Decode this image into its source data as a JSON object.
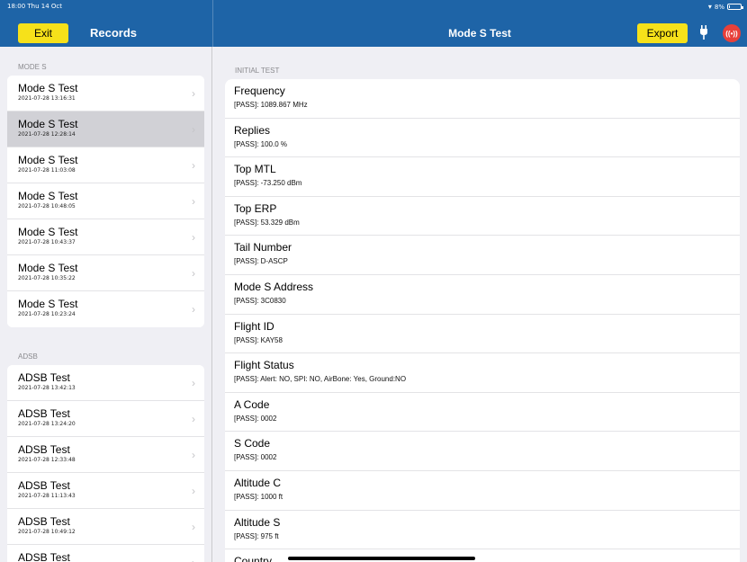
{
  "status": {
    "time": "18:00  Thu 14 Oct",
    "battery": "8%",
    "battery_level": 0.08
  },
  "header": {
    "exit_label": "Exit",
    "records_title": "Records",
    "page_title": "Mode S Test",
    "export_label": "Export",
    "broadcast_glyph": "((•))"
  },
  "sidebar": {
    "mode_s_header": "MODE S",
    "mode_s_items": [
      {
        "title": "Mode S Test",
        "date": "2021-07-28 13:16:31"
      },
      {
        "title": "Mode S Test",
        "date": "2021-07-28 12:28:14",
        "selected": true
      },
      {
        "title": "Mode S Test",
        "date": "2021-07-28 11:03:08"
      },
      {
        "title": "Mode S Test",
        "date": "2021-07-28 10:48:05"
      },
      {
        "title": "Mode S Test",
        "date": "2021-07-28 10:43:37"
      },
      {
        "title": "Mode S Test",
        "date": "2021-07-28 10:35:22"
      },
      {
        "title": "Mode S Test",
        "date": "2021-07-28 10:23:24"
      }
    ],
    "adsb_header": "ADSB",
    "adsb_items": [
      {
        "title": "ADSB Test",
        "date": "2021-07-28 13:42:13"
      },
      {
        "title": "ADSB Test",
        "date": "2021-07-28 13:24:20"
      },
      {
        "title": "ADSB Test",
        "date": "2021-07-28 12:33:48"
      },
      {
        "title": "ADSB Test",
        "date": "2021-07-28 11:13:43"
      },
      {
        "title": "ADSB Test",
        "date": "2021-07-28 10:49:12"
      },
      {
        "title": "ADSB Test",
        "date": ""
      }
    ]
  },
  "main": {
    "section_header": "INITIAL TEST",
    "rows": [
      {
        "title": "Frequency",
        "value": "[PASS]: 1089.867 MHz"
      },
      {
        "title": "Replies",
        "value": "[PASS]: 100.0 %"
      },
      {
        "title": "Top MTL",
        "value": "[PASS]: -73.250 dBm"
      },
      {
        "title": "Top ERP",
        "value": "[PASS]: 53.329 dBm"
      },
      {
        "title": "Tail Number",
        "value": "[PASS]: D-ASCP"
      },
      {
        "title": "Mode S Address",
        "value": "[PASS]: 3C0830"
      },
      {
        "title": "Flight ID",
        "value": "[PASS]: KAY58"
      },
      {
        "title": "Flight Status",
        "value": "[PASS]: Alert: NO, SPI: NO, AirBone: Yes, Ground:NO"
      },
      {
        "title": "A Code",
        "value": "[PASS]: 0002"
      },
      {
        "title": "S Code",
        "value": "[PASS]: 0002"
      },
      {
        "title": "Altitude C",
        "value": "[PASS]: 1000 ft"
      },
      {
        "title": "Altitude S",
        "value": "[PASS]: 975 ft"
      },
      {
        "title": "Country",
        "value": ""
      }
    ]
  }
}
